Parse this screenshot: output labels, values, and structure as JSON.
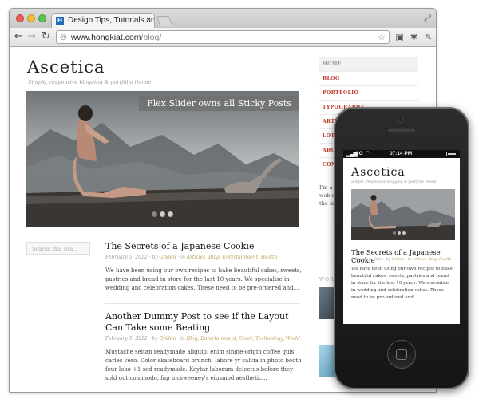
{
  "browser": {
    "tab_title": "Design Tips, Tutorials and In",
    "tab_favicon": "H",
    "url_host": "www.hongkiat.com",
    "url_path": "/blog/",
    "icons": [
      "back-arrow-icon",
      "forward-arrow-icon",
      "reload-icon",
      "globe-icon",
      "star-icon",
      "camera-icon",
      "puzzle-icon",
      "wrench-icon"
    ]
  },
  "site": {
    "title": "Ascetica",
    "tagline": "Simple, responsive blogging & portfolio theme",
    "slider_caption": "Flex Slider owns all Sticky Posts",
    "search_placeholder": "Search this site...",
    "nav": [
      "HOME",
      "BLOG",
      "PORTFOLIO",
      "TYPOGRAPHY",
      "ARTIC",
      "LOTS",
      "ABOU",
      "CONT"
    ],
    "about_text": "I'm a fr specialis been wo have been web stand making gorgeous pieces the sitting",
    "work_label": "WORK"
  },
  "posts": [
    {
      "title": "The Secrets of a Japanese Cookie",
      "date": "February 5, 2012",
      "author": "Griden",
      "categories": "Articles, Blog, Entertainment, Health",
      "excerpt": "We have been using our own recipes to bake beautiful cakes, sweets, pastries and bread in store for the last 10 years. We specialise in wedding and celebration cakes. These need to be pre-ordered and..."
    },
    {
      "title": "Another Dummy Post to see if the Layout Can Take some Beating",
      "date": "February 5, 2012",
      "author": "Griden",
      "categories": "Blog, Entertainment, Sport, Technology, World",
      "excerpt": "Mustache seitan readymade aliquip, enim single-origin coffee quis carles vero. Dolor skateboard brunch, labore yr salvia in photo booth four loko +1 sed readymade. Keytar laborum delectus before they sold out commodo, fap mcsweeney's eiusmod aesthetic..."
    }
  ],
  "meta_words": {
    "by": "by",
    "in": "in"
  },
  "phone": {
    "carrier": "3G",
    "time": "07:14 PM",
    "post": {
      "title": "The Secrets of a Japanese Cookie",
      "date": "February 5, 2012",
      "author": "Griden",
      "categories": "Articles, Blog, Health",
      "excerpt": "We have been using our own recipes to bake beautiful cakes, sweets, pastries and bread in store for the last 10 years. We specialise in wedding and celebration cakes. These need to be pre-ordered and..."
    }
  },
  "colors": {
    "nav_red": "#c0392b",
    "meta_link": "#bfa15a"
  }
}
